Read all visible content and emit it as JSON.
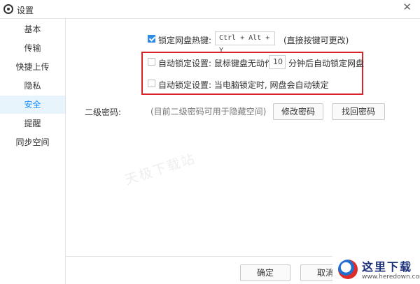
{
  "window": {
    "title": "设置"
  },
  "sidebar": {
    "items": [
      {
        "label": "基本",
        "active": false
      },
      {
        "label": "传输",
        "active": false
      },
      {
        "label": "快捷上传",
        "active": false
      },
      {
        "label": "隐私",
        "active": false
      },
      {
        "label": "安全",
        "active": true
      },
      {
        "label": "提醒",
        "active": false
      },
      {
        "label": "同步空间",
        "active": false
      }
    ]
  },
  "security": {
    "hotkey": {
      "checked": true,
      "label": "锁定网盘热键:",
      "value": "Ctrl + Alt + Y",
      "hint": "(直接按键可更改)"
    },
    "auto_lock_idle": {
      "checked": false,
      "label": "自动锁定设置: 鼠标键盘无动作",
      "minutes": "10",
      "suffix": "分钟后自动锁定网盘"
    },
    "auto_lock_pc": {
      "checked": false,
      "label": "自动锁定设置: 当电脑锁定时, 网盘会自动锁定"
    },
    "second_password": {
      "label": "二级密码:",
      "hint": "(目前二级密码可用于隐藏空间)",
      "modify_label": "修改密码",
      "recover_label": "找回密码"
    }
  },
  "footer": {
    "ok_label": "确定",
    "cancel_label": "取消"
  },
  "watermark": "天极下载站",
  "site_logo": {
    "name": "这里下载",
    "url": "www.heredown.com"
  },
  "colors": {
    "accent": "#1e90ff",
    "active_bg": "#e8f4fc",
    "highlight_frame": "#d8222c"
  }
}
